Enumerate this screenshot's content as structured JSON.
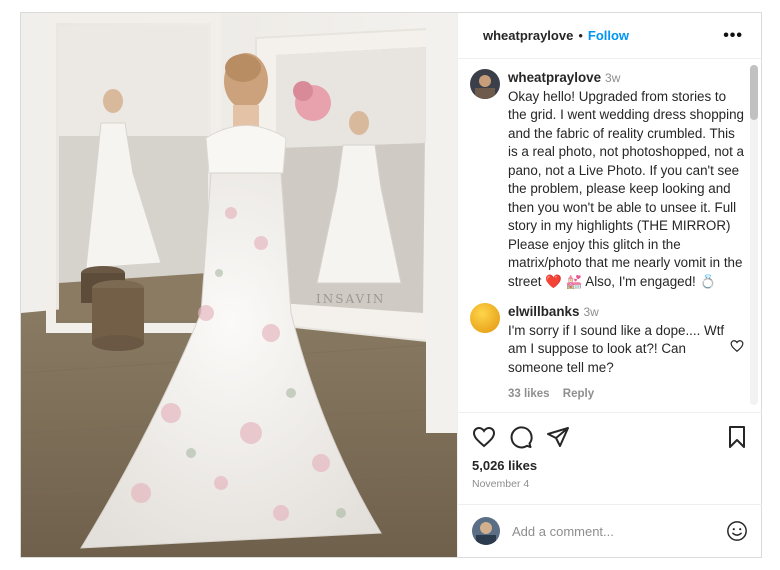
{
  "photo": {
    "mirror_text": "INSAVIN",
    "alt_icon": "wedding-dress-photo"
  },
  "header": {
    "username": "wheatpraylove",
    "separator": "•",
    "follow_label": "Follow",
    "more_label": "•••"
  },
  "caption": {
    "username": "wheatpraylove",
    "time": "3w",
    "text": "Okay hello! Upgraded from stories to the grid. I went wedding dress shopping and the fabric of reality crumbled. This is a real photo, not photoshopped, not a pano, not a Live Photo. If you can't see the problem, please keep looking and then you won't be able to unsee it. Full story in my highlights (THE MIRROR) Please enjoy this glitch in the matrix/photo that me nearly vomit in the street ❤️ 💒 Also, I'm engaged! 💍"
  },
  "comments": [
    {
      "username": "elwillbanks",
      "time": "3w",
      "text": "I'm sorry if I sound like a dope.... Wtf am I suppose to look at?! Can someone tell me?",
      "likes_label": "33 likes",
      "reply_label": "Reply"
    }
  ],
  "actions": {
    "likes": "5,026 likes",
    "date": "November 4"
  },
  "add_comment": {
    "placeholder": "Add a comment..."
  },
  "colors": {
    "accent": "#0095f6",
    "muted": "#8e8e8e",
    "border": "#dbdbdb"
  }
}
